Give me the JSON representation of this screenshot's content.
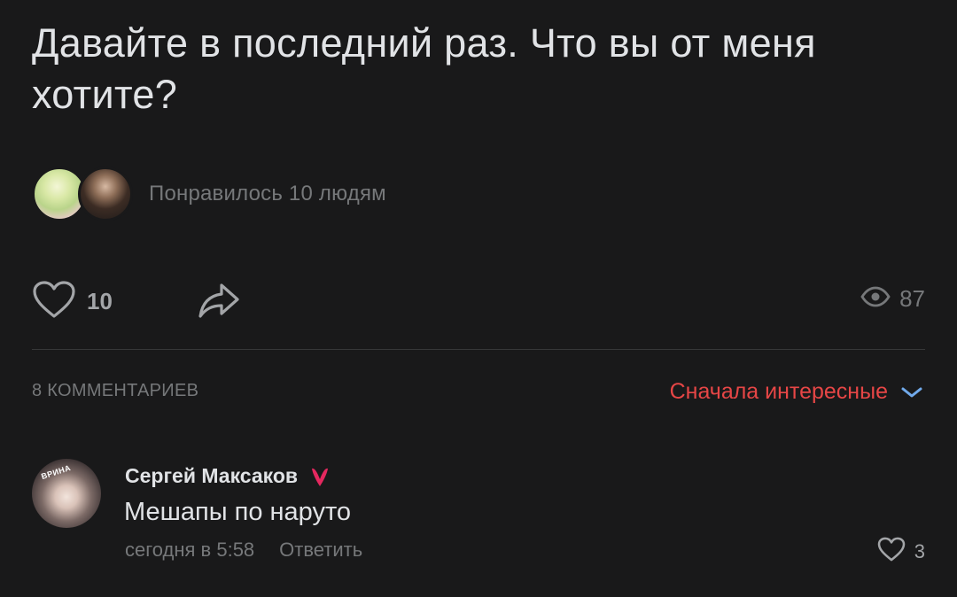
{
  "post": {
    "text": "Давайте в последний раз. Что вы от меня хотите?",
    "likers_label": "Понравилось 10 людям",
    "like_count": "10",
    "view_count": "87"
  },
  "comments": {
    "count_label": "8 КОММЕНТАРИЕВ",
    "sort_label": "Сначала интересные",
    "items": [
      {
        "author": "Сергей Максаков",
        "avatar_tag": "ВРИНА",
        "text": "Мешапы по наруто",
        "time": "сегодня в 5:58",
        "reply_label": "Ответить",
        "like_count": "3"
      }
    ]
  },
  "colors": {
    "background": "#19191a",
    "text_primary": "#e1e3e6",
    "text_secondary": "#76787a",
    "accent_red": "#e64646",
    "accent_blue": "#71aaeb",
    "badge_pink": "#e5285f"
  },
  "icons": {
    "like": "heart-outline-icon",
    "share": "share-arrow-icon",
    "views": "eye-icon",
    "sort": "chevron-down-icon",
    "badge": "heart-badge-icon"
  }
}
